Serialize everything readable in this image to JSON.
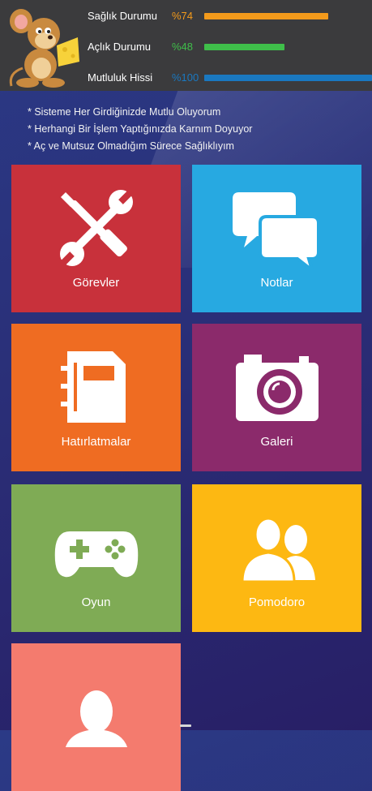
{
  "header": {
    "stats": [
      {
        "label": "Sağlık Durumu",
        "value_text": "%74",
        "value": 74,
        "color": "#f39a1b"
      },
      {
        "label": "Açlık Durumu",
        "value_text": "%48",
        "value": 48,
        "color": "#3fbf4a"
      },
      {
        "label": "Mutluluk Hissi",
        "value_text": "%100",
        "value": 100,
        "color": "#1a78c0"
      }
    ]
  },
  "notes": [
    "* Sisteme Her Girdiğinizde Mutlu Oluyorum",
    "* Herhangi Bir İşlem Yaptığınızda Karnım Doyuyor",
    "* Aç ve Mutsuz Olmadığım Sürece Sağlıklıyım"
  ],
  "tiles": [
    {
      "label": "Görevler",
      "icon": "tools-icon",
      "color": "#c8313b"
    },
    {
      "label": "Notlar",
      "icon": "chat-bubbles-icon",
      "color": "#27a9e1"
    },
    {
      "label": "Hatırlatmalar",
      "icon": "notebook-icon",
      "color": "#ef6c22"
    },
    {
      "label": "Galeri",
      "icon": "camera-icon",
      "color": "#8b2a6b"
    },
    {
      "label": "Oyun",
      "icon": "gamepad-icon",
      "color": "#7fab55"
    },
    {
      "label": "Pomodoro",
      "icon": "people-icon",
      "color": "#fdb812"
    },
    {
      "label": "",
      "icon": "person-icon",
      "color": "#f47b6e"
    }
  ]
}
